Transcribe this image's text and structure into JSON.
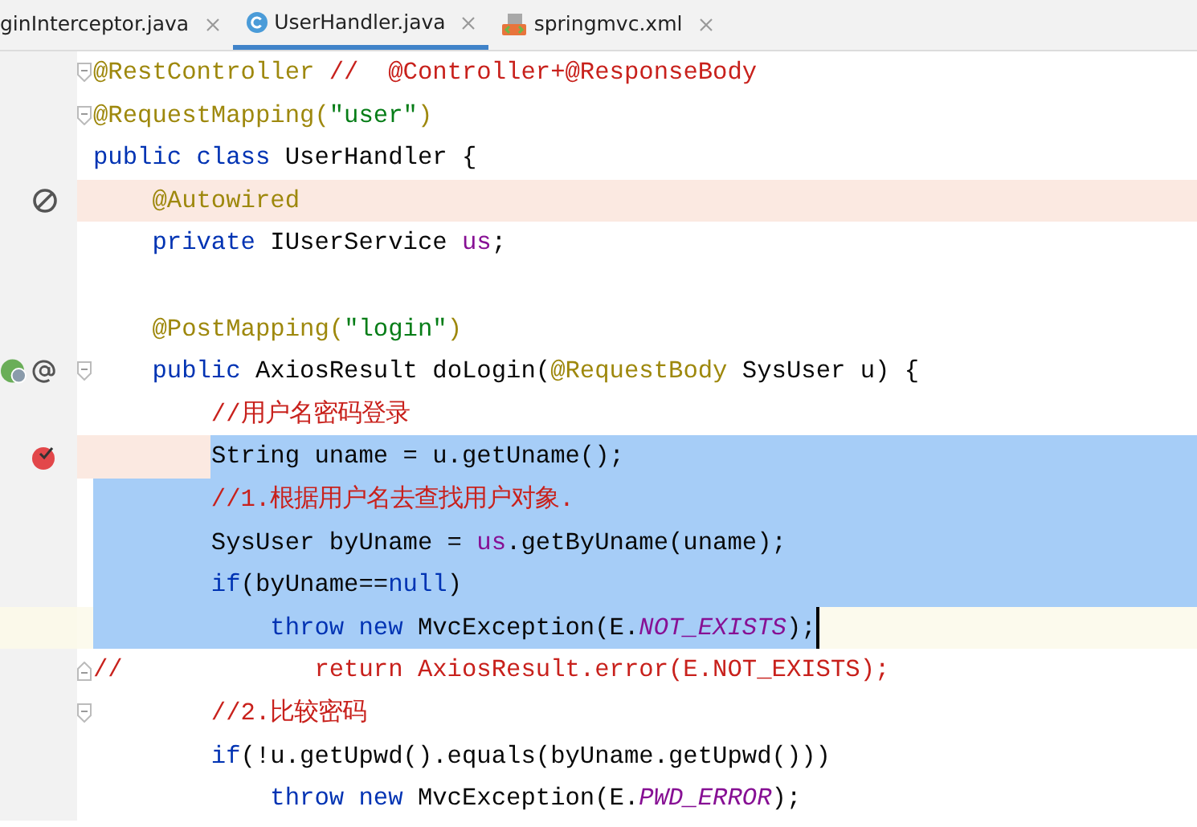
{
  "tabs": [
    {
      "label": "ginInterceptor.java",
      "kind": "plain",
      "selected": false
    },
    {
      "label": "UserHandler.java",
      "kind": "class",
      "selected": true
    },
    {
      "label": "springmvc.xml",
      "kind": "xml",
      "selected": false
    }
  ],
  "lines": [
    {
      "markers": [
        {
          "kind": "fold-start"
        }
      ],
      "tokens": [
        {
          "kind": "annotation",
          "text": "@RestController"
        },
        {
          "kind": "comment",
          "text": " //  @Controller+@ResponseBody"
        }
      ]
    },
    {
      "markers": [
        {
          "kind": "fold-start"
        }
      ],
      "tokens": [
        {
          "kind": "annotation",
          "text": "@RequestMapping("
        },
        {
          "kind": "string",
          "text": "\"user\""
        },
        {
          "kind": "annotation",
          "text": ")"
        }
      ]
    },
    {
      "tokens": [
        {
          "kind": "keyword",
          "text": "public class "
        },
        {
          "kind": "plain",
          "text": "UserHandler {"
        }
      ]
    },
    {
      "highlighted": true,
      "gutter": [
        {
          "kind": "no-entry"
        }
      ],
      "tokens": [
        {
          "kind": "annotation",
          "text": "    @Autowired"
        }
      ]
    },
    {
      "tokens": [
        {
          "kind": "keyword",
          "text": "    private "
        },
        {
          "kind": "plain",
          "text": "IUserService "
        },
        {
          "kind": "field",
          "text": "us"
        },
        {
          "kind": "plain",
          "text": ";"
        }
      ]
    },
    {
      "kind": "blank"
    },
    {
      "tokens": [
        {
          "kind": "annotation",
          "text": "    @PostMapping("
        },
        {
          "kind": "string",
          "text": "\"login\""
        },
        {
          "kind": "annotation",
          "text": ")"
        }
      ]
    },
    {
      "markers": [
        {
          "kind": "fold-start"
        }
      ],
      "gutter": [
        {
          "kind": "bean"
        },
        {
          "kind": "at"
        }
      ],
      "tokens": [
        {
          "kind": "keyword",
          "text": "    public "
        },
        {
          "kind": "plain",
          "text": "AxiosResult doLogin("
        },
        {
          "kind": "annotation",
          "text": "@RequestBody "
        },
        {
          "kind": "plain",
          "text": "SysUser u) {"
        }
      ]
    },
    {
      "tokens": [
        {
          "kind": "comment",
          "text": "        //用户名密码登录"
        }
      ]
    },
    {
      "highlighted": true,
      "selection": {
        "kind": "from-text"
      },
      "gutter": [
        {
          "kind": "breakpoint"
        }
      ],
      "tokens": [
        {
          "kind": "plain",
          "text": "        String uname = u.getUname();"
        }
      ]
    },
    {
      "selection": {
        "kind": "full"
      },
      "tokens": [
        {
          "kind": "comment",
          "text": "        //1.根据用户名去查找用户对象."
        }
      ]
    },
    {
      "selection": {
        "kind": "full"
      },
      "tokens": [
        {
          "kind": "plain",
          "text": "        SysUser byUname = "
        },
        {
          "kind": "field",
          "text": "us"
        },
        {
          "kind": "plain",
          "text": ".getByUname(uname);"
        }
      ]
    },
    {
      "selection": {
        "kind": "full"
      },
      "tokens": [
        {
          "kind": "keyword",
          "text": "        if"
        },
        {
          "kind": "plain",
          "text": "(byUname=="
        },
        {
          "kind": "keyword",
          "text": "null"
        },
        {
          "kind": "plain",
          "text": ")"
        }
      ]
    },
    {
      "selection": {
        "kind": "to-caret"
      },
      "current": true,
      "tokens": [
        {
          "kind": "keyword",
          "text": "            throw new "
        },
        {
          "kind": "plain",
          "text": "MvcException(E."
        },
        {
          "kind": "constant",
          "text": "NOT_EXISTS"
        },
        {
          "kind": "plain",
          "text": ");"
        }
      ]
    },
    {
      "markers": [
        {
          "kind": "fold-end"
        }
      ],
      "tokens": [
        {
          "kind": "comment",
          "text": "//             return AxiosResult.error(E.NOT_EXISTS);"
        }
      ]
    },
    {
      "markers": [
        {
          "kind": "fold-start"
        }
      ],
      "tokens": [
        {
          "kind": "comment",
          "text": "        //2.比较密码"
        }
      ]
    },
    {
      "tokens": [
        {
          "kind": "keyword",
          "text": "        if"
        },
        {
          "kind": "plain",
          "text": "(!u.getUpwd().equals(byUname.getUpwd()))"
        }
      ]
    },
    {
      "tokens": [
        {
          "kind": "keyword",
          "text": "            throw new "
        },
        {
          "kind": "plain",
          "text": "MvcException(E."
        },
        {
          "kind": "constant",
          "text": "PWD_ERROR"
        },
        {
          "kind": "plain",
          "text": ");"
        }
      ]
    }
  ]
}
